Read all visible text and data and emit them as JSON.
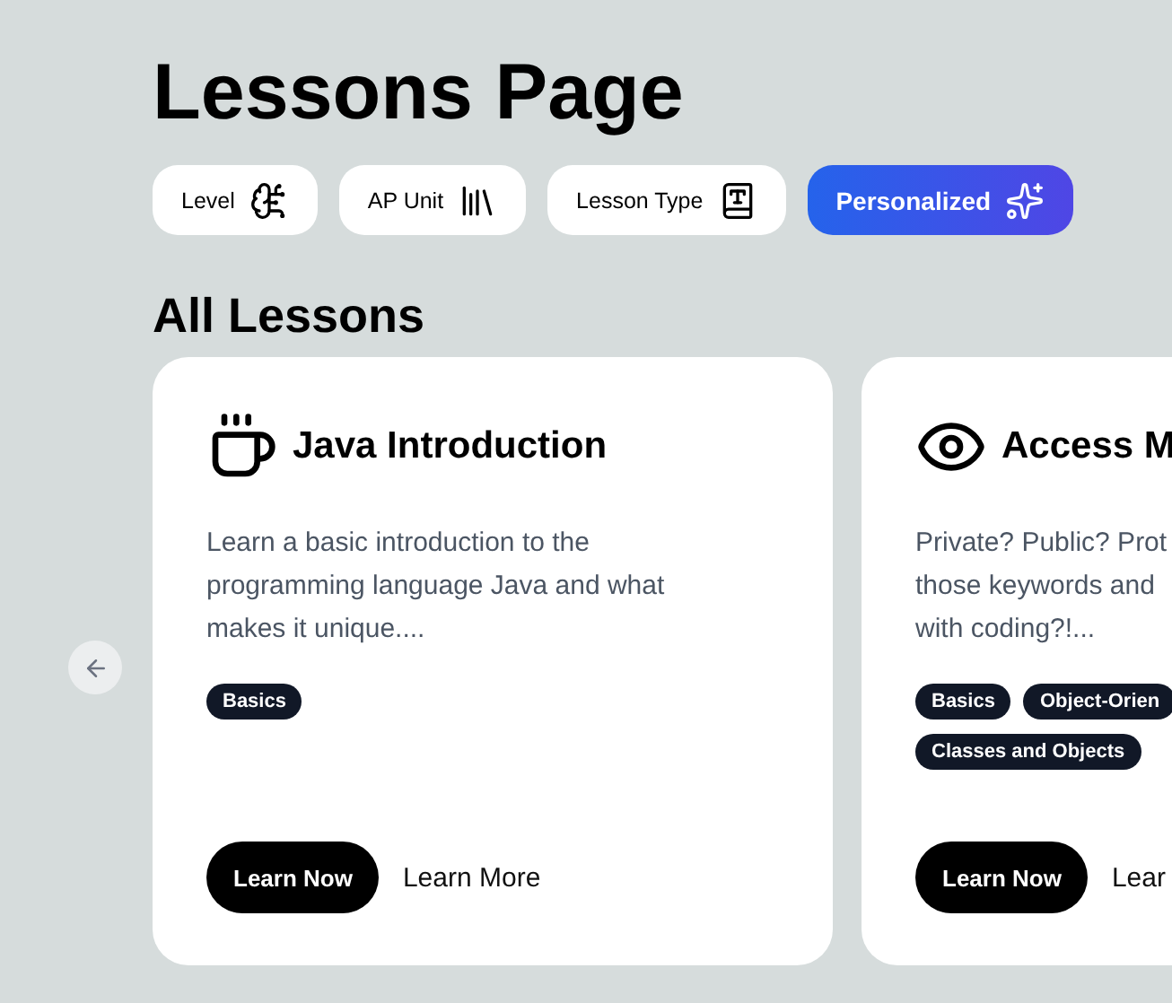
{
  "title": "Lessons Page",
  "filters": [
    {
      "label": "Level",
      "selected": false
    },
    {
      "label": "AP Unit",
      "selected": false
    },
    {
      "label": "Lesson Type",
      "selected": false
    },
    {
      "label": "Personalized",
      "selected": true
    }
  ],
  "section_title": "All Lessons",
  "lessons": [
    {
      "title": "Java Introduction",
      "description_lines": [
        "Learn a basic introduction to the",
        "programming language Java and what",
        "makes it unique...."
      ],
      "tags": [
        [
          "Basics"
        ]
      ],
      "primary_button": "Learn Now",
      "secondary_button": "Learn More"
    },
    {
      "title": "Access M",
      "description_lines": [
        "Private? Public? Prot",
        "those keywords and",
        "with coding?!..."
      ],
      "tags": [
        [
          "Basics",
          "Object-Orien"
        ],
        [
          "Classes and Objects"
        ]
      ],
      "primary_button": "Learn Now",
      "secondary_button": "Lear"
    }
  ]
}
